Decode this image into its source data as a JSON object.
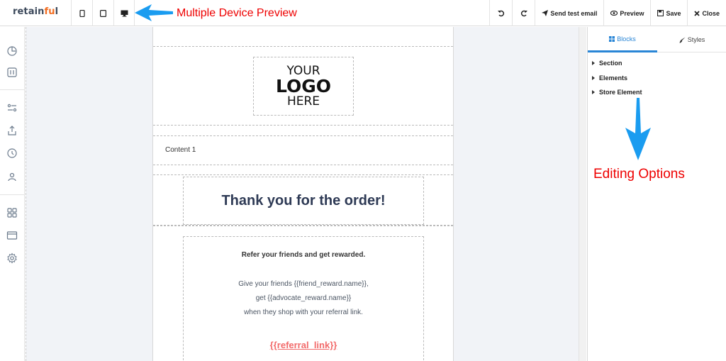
{
  "brand": {
    "pre": "retain",
    "accent": "fu",
    "post": "l"
  },
  "annotations": {
    "top": "Multiple Device Preview",
    "right": "Editing Options",
    "color": "#e00000",
    "arrow_color": "#1a9cf0"
  },
  "toolbar": {
    "send_test_label": "Send test email",
    "preview_label": "Preview",
    "save_label": "Save",
    "close_label": "Close"
  },
  "email": {
    "logo_line1": "YOUR",
    "logo_line2": "LOGO",
    "logo_line3": "HERE",
    "content_label": "Content 1",
    "title": "Thank you for the order!",
    "refer_title": "Refer your friends and get rewarded.",
    "refer_line1": "Give your friends {{friend_reward.name}},",
    "refer_line2": "get {{advocate_reward.name}}",
    "refer_line3": "when they shop with your referral link.",
    "refer_link": "{{referral_link}}"
  },
  "panel": {
    "tabs": [
      {
        "label": "Blocks",
        "active": true
      },
      {
        "label": "Styles",
        "active": false
      }
    ],
    "items": [
      {
        "label": "Section"
      },
      {
        "label": "Elements"
      },
      {
        "label": "Store Element"
      }
    ]
  },
  "colors": {
    "accent": "#2a86d6",
    "brand_accent": "#f26d21",
    "link": "#f26b6b",
    "title": "#2e3a55"
  }
}
